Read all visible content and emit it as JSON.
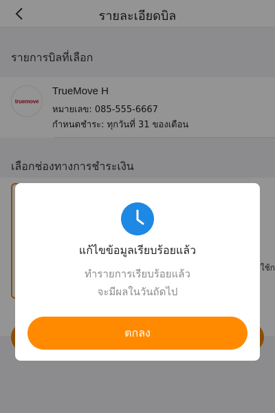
{
  "header": {
    "title": "รายละเอียดบิล"
  },
  "selected_bill": {
    "section_label": "รายการบิลที่เลือก",
    "provider_logo_text": "truemove",
    "provider_name": "TrueMove H",
    "number_line": "หมายเลข: 085-555-6667",
    "due_line": "กำหนดชำระ: ทุกวันที่ 31 ของเดือน"
  },
  "payment": {
    "section_label": "เลือกช่องทางการชำระเงิน",
    "side_fragment": "ใช้ก"
  },
  "modal": {
    "icon": "clock-icon",
    "title": "แก้ไขข้อมูลเรียบร้อยแล้ว",
    "message_line1": "ทำรายการเรียบร้อยแล้ว",
    "message_line2": "จะมีผลในวันถัดไป",
    "ok_label": "ตกลง"
  },
  "colors": {
    "accent": "#ff8a00",
    "icon_blue": "#1e88e5",
    "overlay": "rgba(0,0,0,0.42)"
  }
}
